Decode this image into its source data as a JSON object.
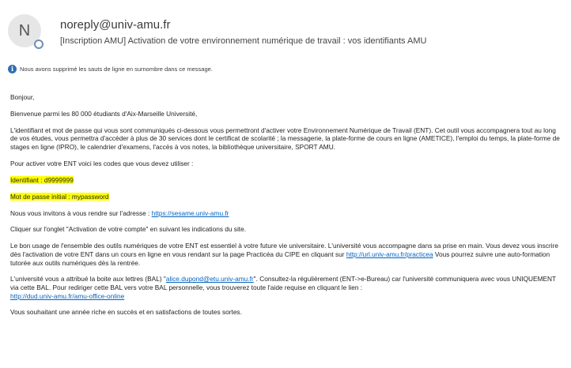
{
  "header": {
    "avatar_letter": "N",
    "sender": "noreply@univ-amu.fr",
    "subject": "[Inscription AMU] Activation de votre environnement numérique de travail : vos identifiants AMU"
  },
  "info": {
    "text": "Nous avons supprimé les sauts de ligne en surnombre dans ce message."
  },
  "body": {
    "greeting": "Bonjour,",
    "welcome": "Bienvenue parmi les 80 000 étudiants d'Aix-Marseille Université,",
    "intro": "L'identifiant et mot de passe qui vous sont communiqués ci-dessous vous permettront d'activer votre Environnement Numérique de Travail (ENT). Cet outil vous accompagnera tout au long de vos études, vous permettra d'accéder à plus de 30 services dont le certificat de scolarité ; la messagerie, la plate-forme de cours en ligne (AMETICE), l'emploi du temps, la plate-forme de stages en ligne (IPRO), le calendrier d'examens, l'accès à vos notes, la bibliothèque universitaire, SPORT AMU.",
    "codes_intro": "Pour activer votre ENT voici les codes que vous devez utiliser :",
    "identifier": "Identifiant : d9999999",
    "password": "Mot de passe initial : mypassword",
    "invite_text": "Nous vous invitons à vous rendre sur l'adresse : ",
    "invite_link": "https://sesame.univ-amu.fr",
    "click_tab": "Cliquer sur l'onglet \"Activation de votre compte\" en suivant les indications du site.",
    "usage_text": "Le bon usage de l'ensemble des outils numériques de votre ENT est essentiel à votre future vie universitaire. L'université vous accompagne dans sa prise en main. Vous devez vous inscrire dès l'activation de votre ENT dans un cours en ligne en vous rendant sur la page Practicéa du CIPE en cliquant sur ",
    "usage_link": "http://url.univ-amu.fr/practicea",
    "usage_text2": " Vous pourrez suivre une auto-formation tutorée aux outils numériques dès la rentrée.",
    "mailbox_text": "L'université vous a attribué la boite aux lettres (BAL) \"",
    "mailbox_link": "alice.dupond@etu.univ-amu.fr",
    "mailbox_text2": "\". Consultez-la régulièrement (ENT->e-Bureau) car l'université communiquera avec vous UNIQUEMENT via cette BAL. Pour rediriger cette BAL vers votre BAL personnelle, vous trouverez toute l'aide requise en cliquant le lien :",
    "mailbox_link2": "http://dud.univ-amu.fr/amu-office-online",
    "closing": "Vous souhaitant une année riche en succès et en satisfactions de toutes sortes."
  }
}
